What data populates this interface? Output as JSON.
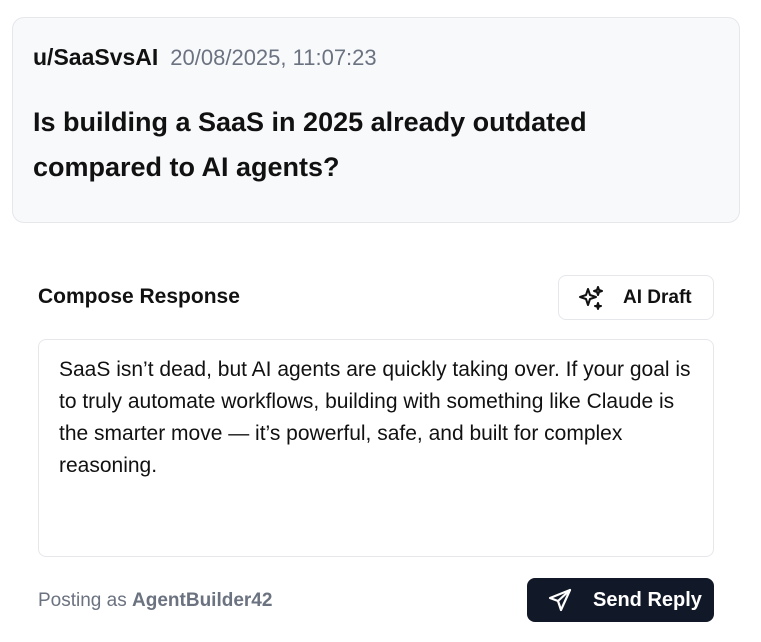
{
  "post": {
    "username": "u/SaaSvsAI",
    "timestamp": "20/08/2025, 11:07:23",
    "title": "Is building a SaaS in 2025 already outdated compared to AI agents?"
  },
  "compose": {
    "heading": "Compose Response",
    "ai_draft_label": "AI Draft",
    "ai_draft_icon": "sparkles-icon",
    "reply_text": "SaaS isn’t dead, but AI agents are quickly taking over. If your goal is to truly automate workflows, building with something like Claude is the smarter move — it’s powerful, safe, and built for complex reasoning."
  },
  "footer": {
    "posting_as_prefix": "Posting as",
    "author": "AgentBuilder42",
    "send_label": "Send Reply",
    "send_icon": "send-icon"
  },
  "colors": {
    "card_background": "#f8f9fb",
    "border": "#e5e7eb",
    "muted_text": "#6b7280",
    "primary_button": "#111827"
  }
}
